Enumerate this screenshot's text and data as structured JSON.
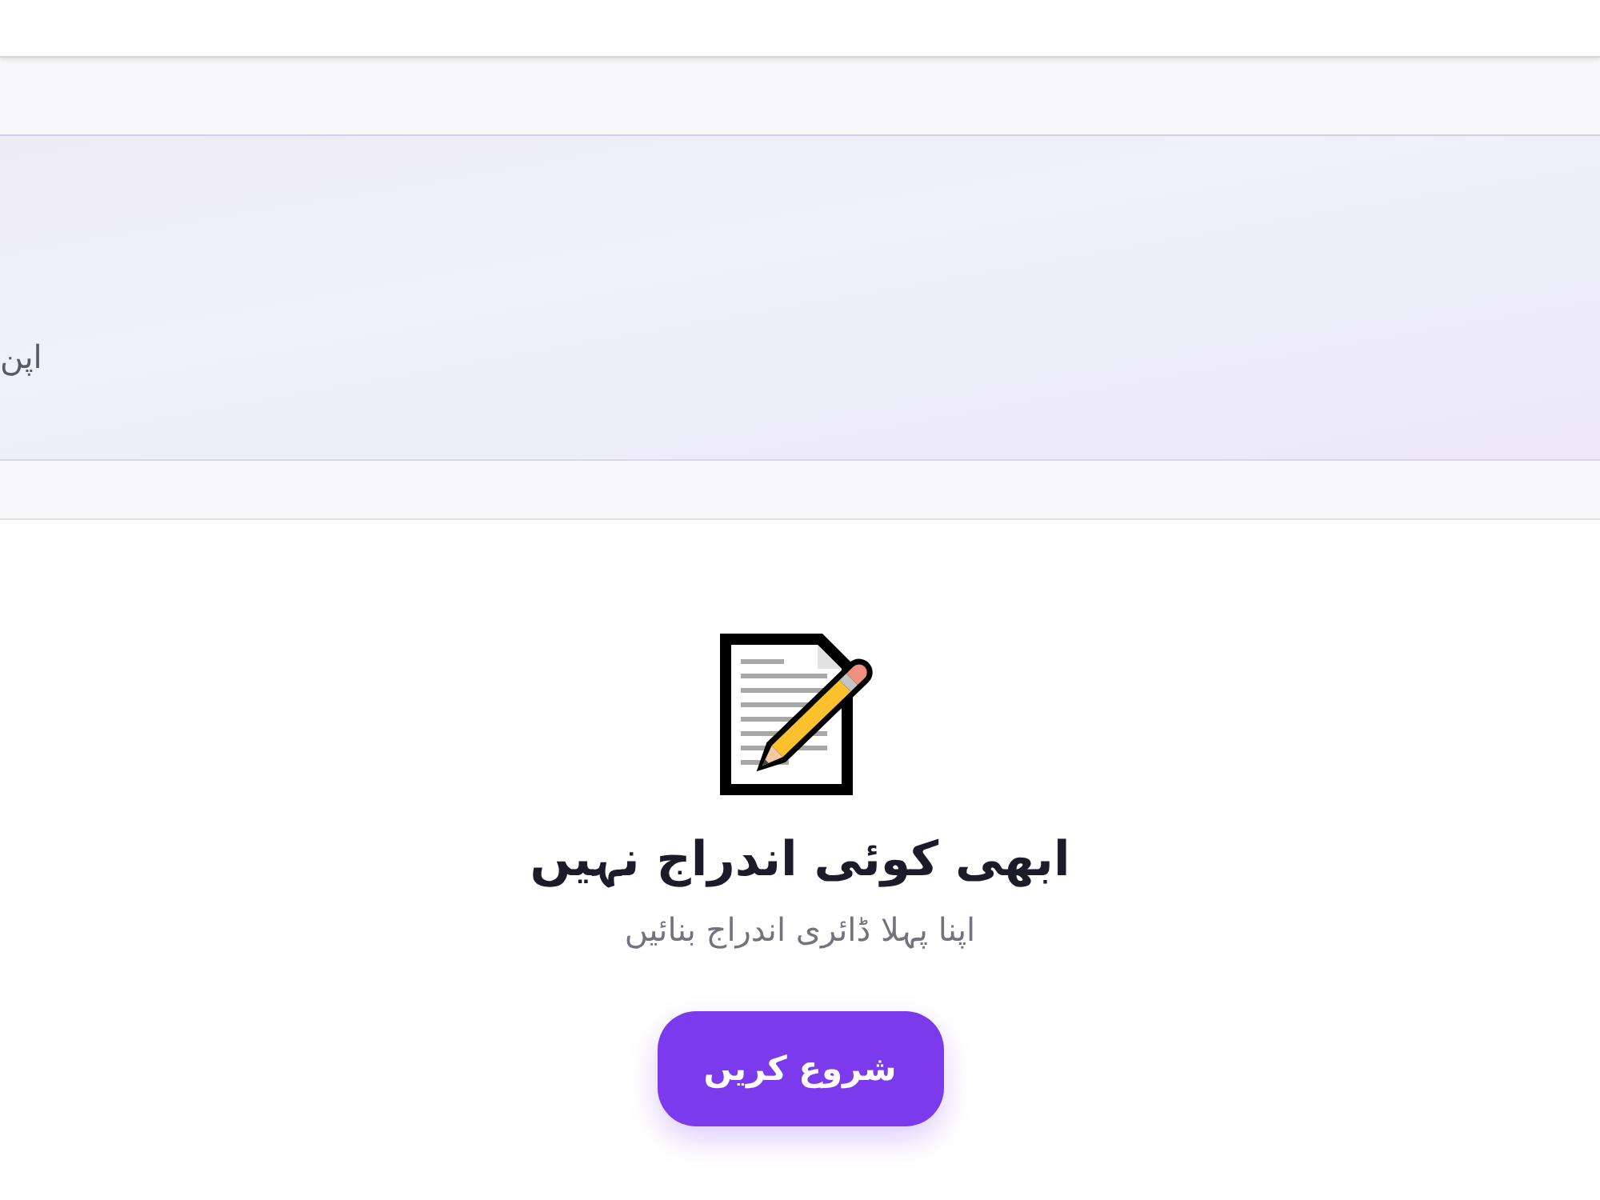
{
  "banner": {
    "text": "اپن"
  },
  "empty_state": {
    "title": "ابھی کوئی اندراج نہیں",
    "subtitle": "اپنا پہلا ڈائری اندراج بنائیں",
    "button": "شروع کریں"
  }
}
